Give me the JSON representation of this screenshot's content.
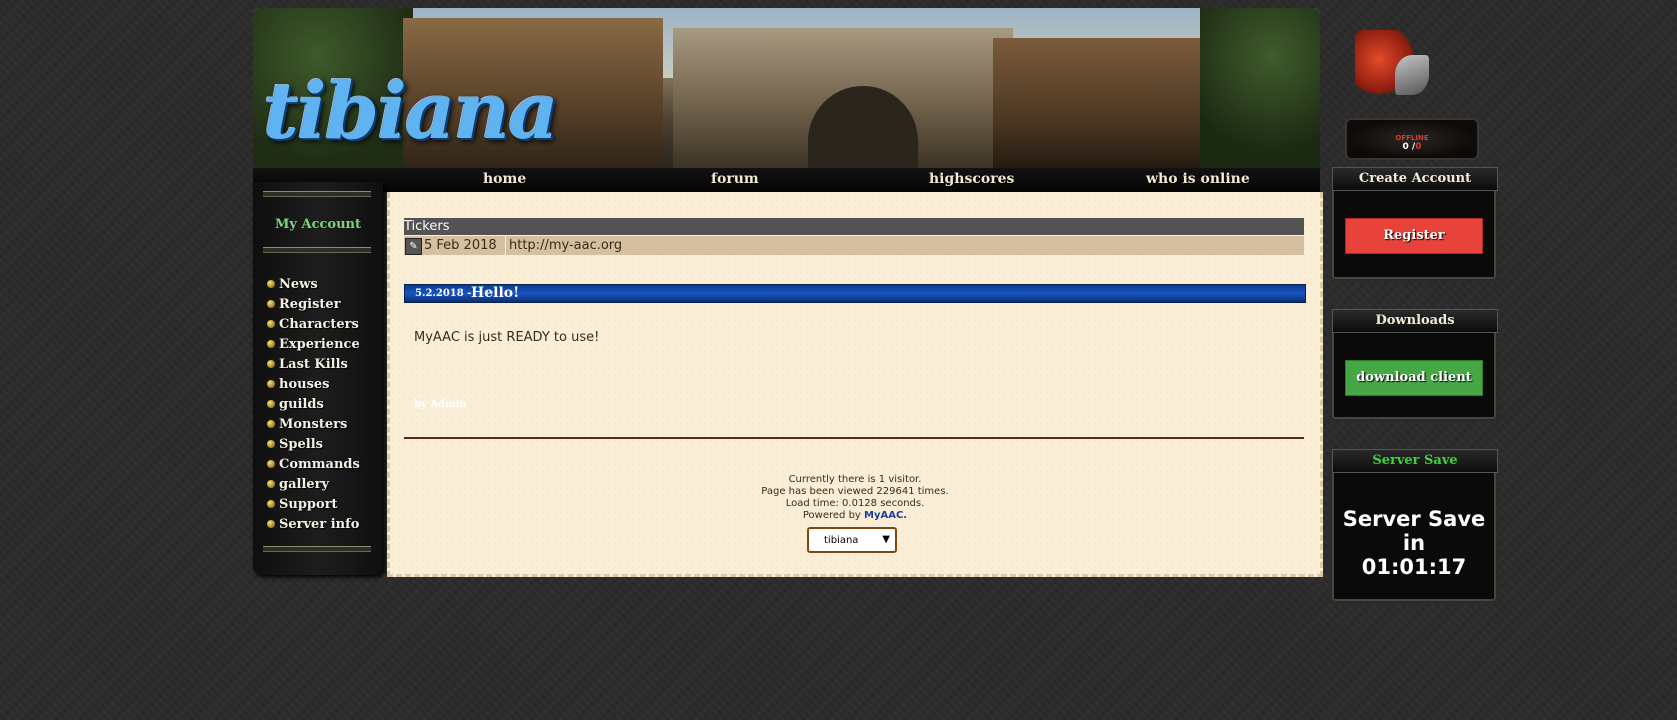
{
  "header": {
    "logo_text": "tibiana"
  },
  "nav": {
    "items": [
      "home",
      "forum",
      "highscores",
      "who is online"
    ]
  },
  "sidebar": {
    "my_account": "My Account",
    "items": [
      "News",
      "Register",
      "Characters",
      "Experience",
      "Last Kills",
      "houses",
      "guilds",
      "Monsters",
      "Spells",
      "Commands",
      "gallery",
      "Support",
      "Server info"
    ]
  },
  "tickers": {
    "title": "Tickers",
    "icon": "scroll-icon",
    "date": "5 Feb 2018",
    "text": "http://my-aac.org"
  },
  "news": {
    "date": "5.2.2018 -",
    "title": "Hello!",
    "body": "MyAAC is just READY to use!",
    "author": "by Admin"
  },
  "footer": {
    "visitors": "Currently there is 1 visitor.",
    "views": "Page has been viewed 229641 times.",
    "load_time": "Load time: 0.0128 seconds.",
    "powered_prefix": "Powered by ",
    "powered_link": "MyAAC.",
    "template_selected": "tibiana"
  },
  "status": {
    "state": "OFFLINE",
    "online": "0",
    "separator": "/",
    "max": "0"
  },
  "panels": {
    "create_account_title": "Create Account",
    "register_button": "Register",
    "downloads_title": "Downloads",
    "download_button": "download client",
    "server_save_title": "Server Save",
    "server_save_line1": "Server Save",
    "server_save_line2": "in",
    "server_save_time": "01:01:17"
  },
  "colors": {
    "register_button": "#e8433a",
    "download_button": "#45a845",
    "server_save_title": "#3ed23e",
    "my_account": "#7bd67b"
  }
}
